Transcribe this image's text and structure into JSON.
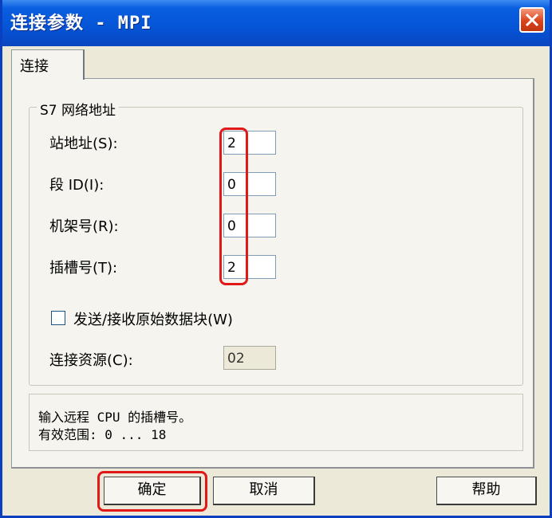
{
  "window": {
    "title": "连接参数 - MPI"
  },
  "tabs": [
    {
      "label": "连接"
    }
  ],
  "group": {
    "title": "S7 网络地址",
    "fields": [
      {
        "label": "站地址(S):",
        "value": "2"
      },
      {
        "label": "段 ID(I):",
        "value": "0"
      },
      {
        "label": "机架号(R):",
        "value": "0"
      },
      {
        "label": "插槽号(T):",
        "value": "2"
      }
    ],
    "checkbox_label": "发送/接收原始数据块(W)",
    "checkbox_checked": false,
    "resource_label": "连接资源(C):",
    "resource_value": "02"
  },
  "info": {
    "line1": "输入远程 CPU 的插槽号。",
    "line2": "有效范围: 0 ... 18"
  },
  "buttons": {
    "ok": "确定",
    "cancel": "取消",
    "help": "帮助"
  },
  "colors": {
    "title_bar": "#0554d6",
    "highlight": "#e01818",
    "dialog_bg": "#ece9d8"
  }
}
